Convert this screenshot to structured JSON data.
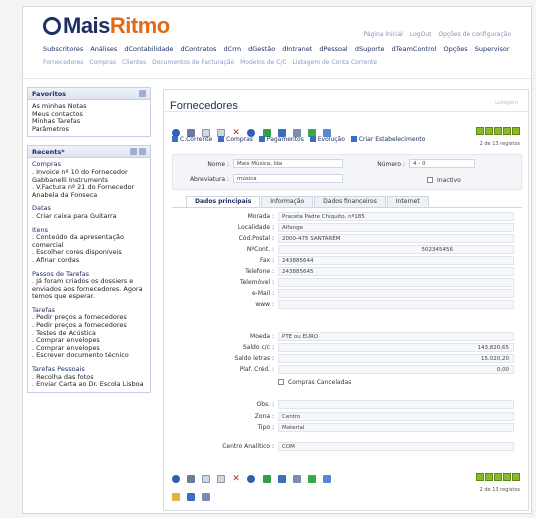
{
  "app": {
    "logo_main": "Mais",
    "logo_accent": "Ritmo"
  },
  "toplinks": [
    "Página Inicial",
    "LogOut",
    "Opções de configuração"
  ],
  "mainnav": [
    "Subscritores",
    "Análises",
    "dContabilidade",
    "dContratos",
    "dCrm",
    "dGestão",
    "dIntranet",
    "dPessoal",
    "dSuporte",
    "dTeamControl",
    "Opções",
    "Supervisor"
  ],
  "subnav": [
    "Fornecedores",
    "Compras",
    "Clientes",
    "Documentos de Facturação",
    "Modelos de C/C",
    "Listagem de Conta Corrente"
  ],
  "sidebar": {
    "favoritos": {
      "title": "Favoritos",
      "items": [
        "As minhas Notas",
        "Meus contactos",
        "Minhas Tarefas",
        "Parâmetros"
      ]
    },
    "recents": {
      "title": "Recents*",
      "sections": [
        {
          "title": "Compras",
          "items": [
            ". Invoice nº 10 do Fornecedor Gabbanelli Instruments",
            ". V.Factura nº 21 do Fornecedor Anabela da Fonseca"
          ]
        },
        {
          "title": "Datas",
          "items": [
            ". Criar caixa para Guitarra"
          ]
        },
        {
          "title": "Itens",
          "items": [
            ". Conteúdo da apresentação comercial",
            ". Escolher cores disponíveis",
            ". Afinar cordas"
          ]
        },
        {
          "title": "Passos de Tarefas",
          "items": [
            ". Já foram criados os dossiers e enviados aos fornecedores. Agora temos que esperar."
          ]
        },
        {
          "title": "Tarefas",
          "items": [
            ". Pedir preços a fornecedores",
            ". Pedir preços a fornecedores",
            ". Testes de Acústica",
            ". Comprar envelopes",
            ". Comprar envelopes",
            ". Escrever documento técnico"
          ]
        },
        {
          "title": "Tarefas Pessoais",
          "items": [
            ". Recolha das fotos",
            ". Enviar Carta ao Dr. Escola Lisboa"
          ]
        }
      ]
    }
  },
  "main": {
    "title": "Fornecedores",
    "title_right": "Listagem",
    "pager_text": "2 de 13 registos",
    "related_links": [
      "C.Corrente",
      "Compras",
      "Pagamentos",
      "Evolução",
      "Criar Estabelecimento"
    ],
    "header_fields": {
      "nome_label": "Nome :",
      "nome_value": "Mais Música, lda",
      "numero_label": "Número :",
      "numero_value": "4 - 0",
      "abrev_label": "Abreviatura :",
      "abrev_value": "música",
      "inactivo_label": "Inactivo"
    },
    "tabs": [
      "Dados principais",
      "Informação",
      "Dados financeiros",
      "Internet"
    ],
    "fields": [
      {
        "label": "Morada :",
        "value": "Praceta Padre Chiquito, nº185"
      },
      {
        "label": "Localidade :",
        "value": "Alfange"
      },
      {
        "label": "Cód.Postal :",
        "value": "2000-475 SANTARÉM"
      },
      {
        "label": "NºCont. :",
        "value": "",
        "value_right": "502345456"
      },
      {
        "label": "Fax :",
        "value": "243885644"
      },
      {
        "label": "Telefone :",
        "value": "243885645"
      },
      {
        "label": "Telemóvel :",
        "value": ""
      },
      {
        "label": "e-Mail :",
        "value": ""
      },
      {
        "label": "www :",
        "value": ""
      },
      {
        "label": "Moeda :",
        "value": "PTE ou EURO"
      },
      {
        "label": "Saldo c/c :",
        "value": "143.820,65"
      },
      {
        "label": "Saldo letras :",
        "value": "15.020,20"
      },
      {
        "label": "Plaf. Créd. :",
        "value": "0,00"
      },
      {
        "label": "Compras Canceladas",
        "value": ""
      },
      {
        "label": "Obs. :",
        "value": ""
      },
      {
        "label": "Zona :",
        "value": "Centro"
      },
      {
        "label": "Tipo :",
        "value": "Material"
      },
      {
        "label": "Centro Analítico :",
        "value": "COM"
      }
    ]
  },
  "colors": {
    "brand_blue": "#1e2f63",
    "brand_orange": "#e26a17",
    "pager_green": "#8cb92a"
  }
}
